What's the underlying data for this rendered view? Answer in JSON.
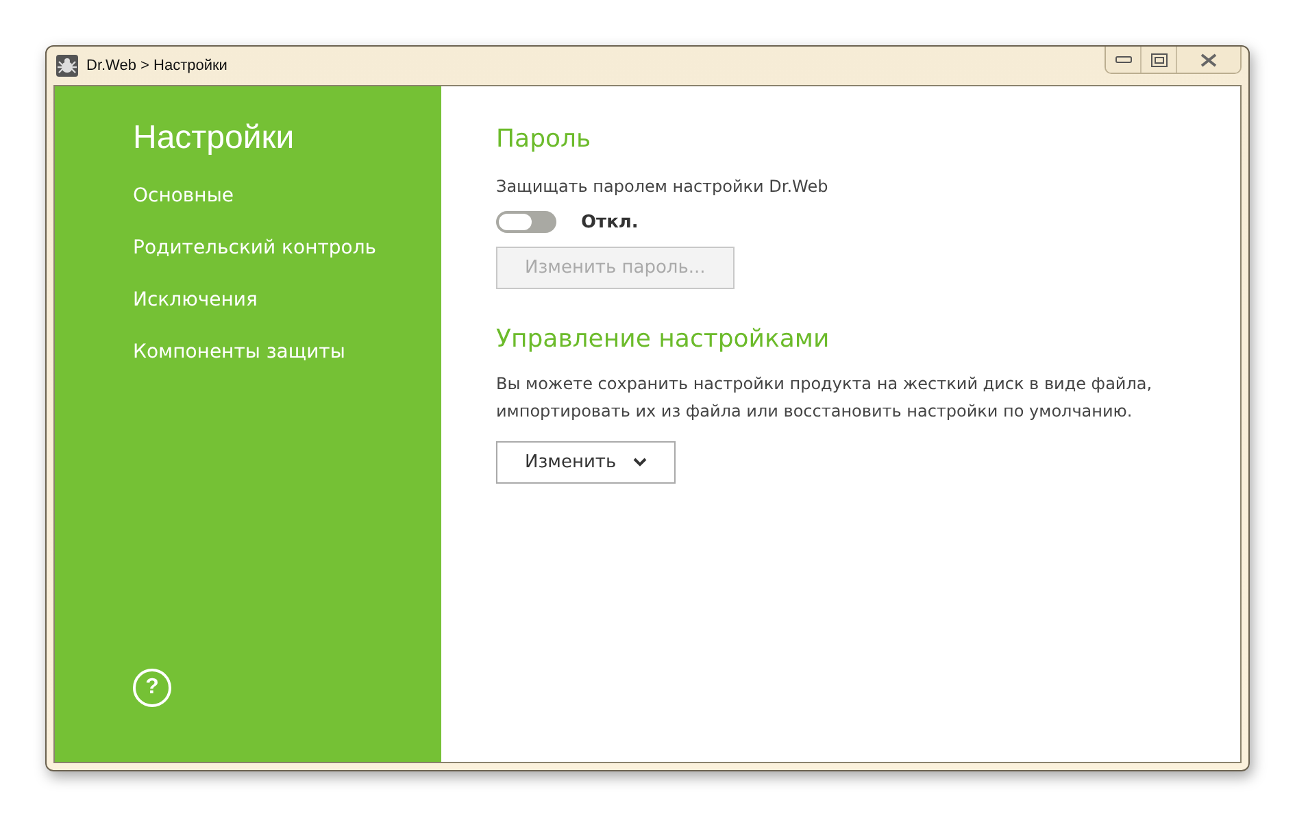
{
  "window": {
    "title": "Dr.Web > Настройки"
  },
  "sidebar": {
    "title": "Настройки",
    "items": [
      {
        "label": "Основные"
      },
      {
        "label": "Родительский контроль"
      },
      {
        "label": "Исключения"
      },
      {
        "label": "Компоненты защиты"
      }
    ],
    "help": "?"
  },
  "password": {
    "heading": "Пароль",
    "description": "Защищать паролем настройки Dr.Web",
    "toggle": {
      "on": false,
      "label": "Откл."
    },
    "button": {
      "label": "Изменить пароль...",
      "disabled": true
    }
  },
  "management": {
    "heading": "Управление настройками",
    "description": "Вы можете сохранить настройки продукта на жесткий диск в виде файла, импортировать их из файла или восстановить настройки по умолчанию.",
    "button": {
      "label": "Изменить"
    }
  }
}
